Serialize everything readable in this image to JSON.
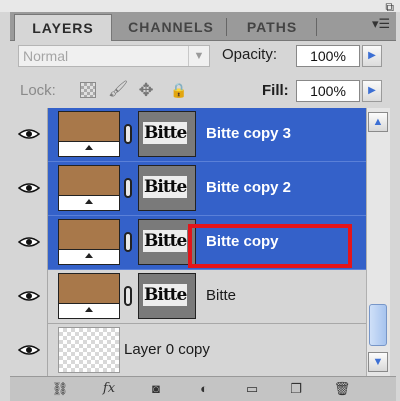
{
  "panel": {
    "tabs": [
      {
        "label": "LAYERS",
        "active": true
      },
      {
        "label": "CHANNELS",
        "active": false
      },
      {
        "label": "PATHS",
        "active": false
      }
    ],
    "menu_icon": "panel-menu-icon"
  },
  "controls": {
    "blend_mode": "Normal",
    "opacity_label": "Opacity:",
    "opacity_value": "100%",
    "lock_label": "Lock:",
    "fill_label": "Fill:",
    "fill_value": "100%"
  },
  "layers": [
    {
      "name": "Bitte copy 3",
      "selected": true,
      "visible": true,
      "mask_text": "Bitte",
      "thumb": "brown"
    },
    {
      "name": "Bitte copy 2",
      "selected": true,
      "visible": true,
      "mask_text": "Bitte",
      "thumb": "brown"
    },
    {
      "name": "Bitte copy",
      "selected": true,
      "visible": true,
      "mask_text": "Bitte",
      "thumb": "brown"
    },
    {
      "name": "Bitte",
      "selected": false,
      "visible": true,
      "mask_text": "Bitte",
      "thumb": "brown"
    },
    {
      "name": "Layer 0 copy",
      "selected": false,
      "visible": true,
      "thumb": "transparent"
    }
  ],
  "colors": {
    "selection": "#3461c9",
    "highlight": "#e3141a",
    "layer_thumb": "#a8784a",
    "panel_bg": "#d6d6d6"
  },
  "bottom_icons": [
    "link-layers-icon",
    "fx-icon",
    "add-mask-icon",
    "adjustment-layer-icon",
    "new-group-icon",
    "new-layer-icon",
    "delete-layer-icon"
  ]
}
